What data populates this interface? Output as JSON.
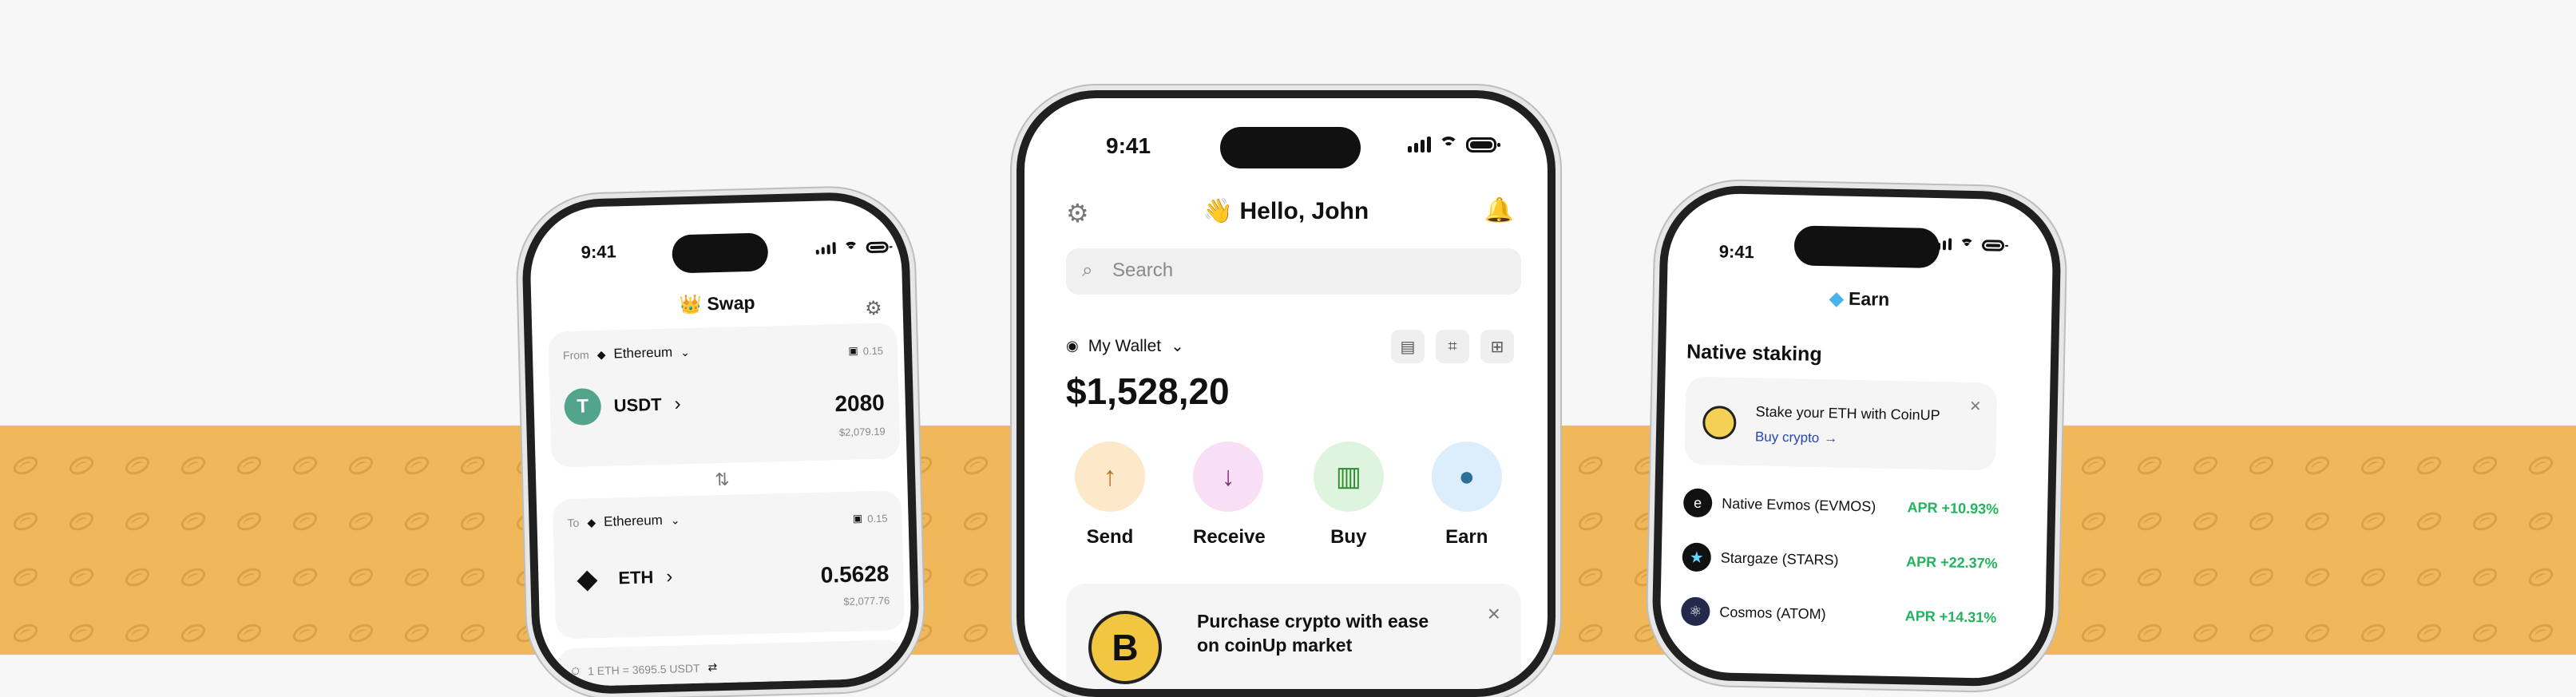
{
  "colors": {
    "accent_yellow": "#f0b85a",
    "positive_green": "#22b45c",
    "phone_frame": "#202020"
  },
  "left_phone": {
    "status_time": "9:41",
    "title": "Swap",
    "from_label": "From",
    "from_network": "Ethereum",
    "from_balance": "0.15",
    "from_token": "USDT",
    "from_amount": "2080",
    "from_fiat": "$2,079.19",
    "to_label": "To",
    "to_network": "Ethereum",
    "to_balance": "0.15",
    "to_token": "ETH",
    "to_amount": "0.5628",
    "to_fiat": "$2,077.76",
    "rate": "1 ETH = 3695.5 USDT"
  },
  "center_phone": {
    "status_time": "9:41",
    "greeting": "Hello, John",
    "search_placeholder": "Search",
    "wallet_label": "My Wallet",
    "balance": "$1,528,20",
    "actions": [
      {
        "label": "Send",
        "icon": "arrow-up-icon",
        "bg": "#fde9c9"
      },
      {
        "label": "Receive",
        "icon": "arrow-down-icon",
        "bg": "#f8dff5"
      },
      {
        "label": "Buy",
        "icon": "cash-icon",
        "bg": "#dff4df"
      },
      {
        "label": "Earn",
        "icon": "piggy-bank-icon",
        "bg": "#dceefb"
      }
    ],
    "promo_title": "Purchase crypto with ease",
    "promo_subtitle": "on coinUp market"
  },
  "right_phone": {
    "status_time": "9:41",
    "title": "Earn",
    "section_title": "Native staking",
    "promo_text": "Stake your ETH with CoinUP",
    "promo_link": "Buy crypto",
    "assets": [
      {
        "name": "Native Evmos (EVMOS)",
        "apr": "APR +10.93%"
      },
      {
        "name": "Stargaze (STARS)",
        "apr": "APR +22.37%"
      },
      {
        "name": "Cosmos (ATOM)",
        "apr": "APR +14.31%"
      }
    ]
  }
}
